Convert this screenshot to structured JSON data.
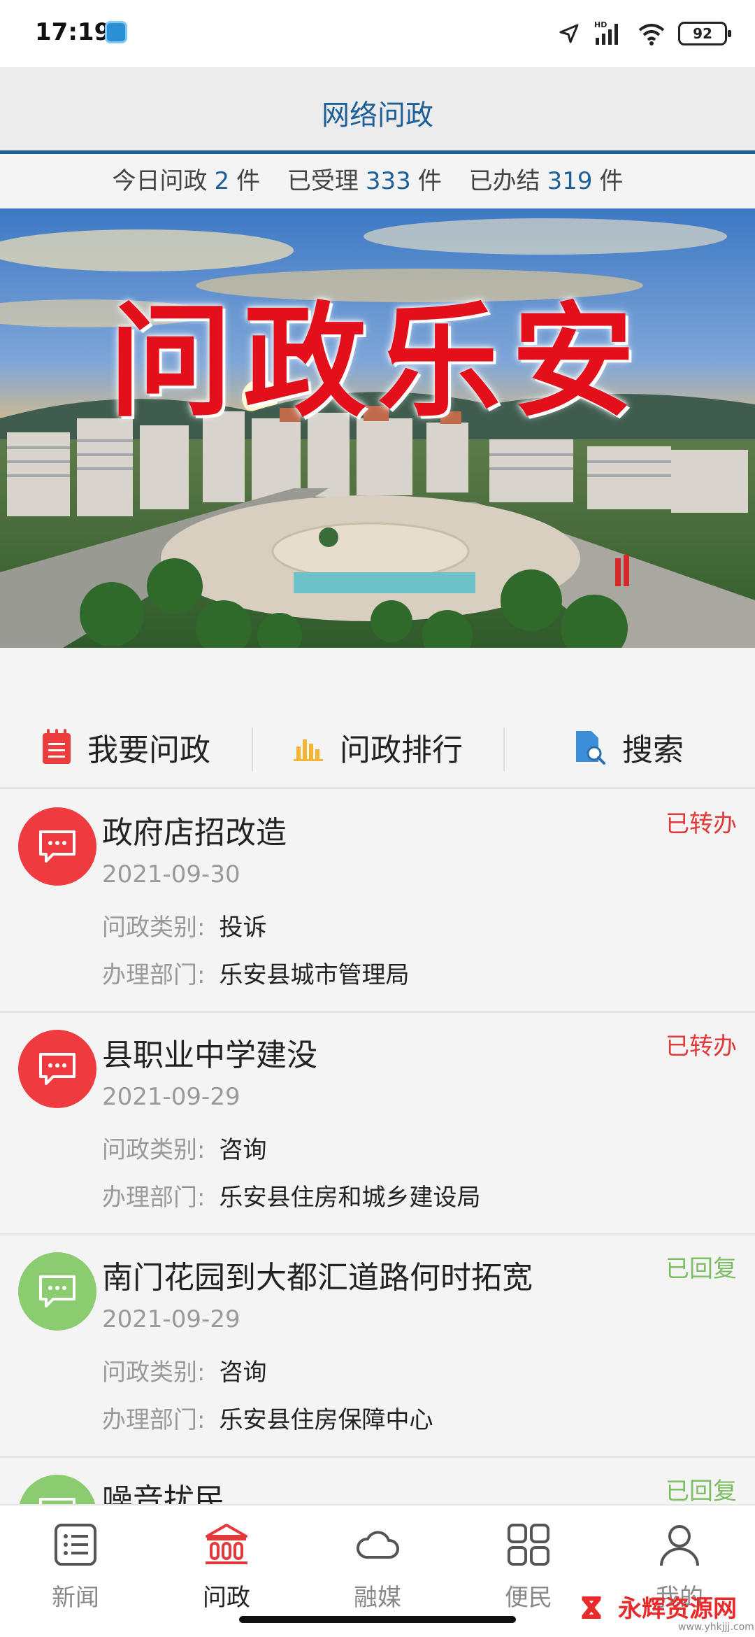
{
  "status_bar": {
    "time": "17:19",
    "network": "HD",
    "battery": "92"
  },
  "header": {
    "title": "网络问政"
  },
  "stats": {
    "today_label": "今日问政",
    "today_count": "2",
    "today_unit": "件",
    "accepted_label": "已受理",
    "accepted_count": "333",
    "accepted_unit": "件",
    "done_label": "已办结",
    "done_count": "319",
    "done_unit": "件"
  },
  "banner": {
    "title": "问政乐安"
  },
  "actions": [
    {
      "label": "我要问政",
      "icon": "clipboard-icon"
    },
    {
      "label": "问政排行",
      "icon": "bar-chart-icon"
    },
    {
      "label": "搜索",
      "icon": "search-doc-icon"
    }
  ],
  "field_labels": {
    "category": "问政类别:",
    "department": "办理部门:"
  },
  "items": [
    {
      "title": "政府店招改造",
      "date": "2021-09-30",
      "category": "投诉",
      "department": "乐安县城市管理局",
      "status": "已转办",
      "status_color": "#e23a3a",
      "avatar_color": "#ef3a3f"
    },
    {
      "title": "县职业中学建没",
      "date": "2021-09-29",
      "category": "咨询",
      "department": "乐安县住房和城乡建设局",
      "status": "已转办",
      "status_color": "#e23a3a",
      "avatar_color": "#ef3a3f"
    },
    {
      "title": "南门花园到大都汇道路何时拓宽",
      "date": "2021-09-29",
      "category": "咨询",
      "department": "乐安县住房保障中心",
      "status": "已回复",
      "status_color": "#7cbf62",
      "avatar_color": "#8ccc71"
    },
    {
      "title": "噪音扰民",
      "status": "已回复",
      "status_color": "#7cbf62",
      "avatar_color": "#8ccc71"
    }
  ],
  "tabs": [
    {
      "label": "新闻",
      "icon": "news-list-icon"
    },
    {
      "label": "问政",
      "icon": "government-building-icon",
      "active": true
    },
    {
      "label": "融媒",
      "icon": "cloud-icon"
    },
    {
      "label": "便民",
      "icon": "grid-icon"
    },
    {
      "label": "我的",
      "icon": "user-icon"
    }
  ],
  "watermark": {
    "text": "永辉资源网",
    "url": "www.yhkjjj.com"
  },
  "colors": {
    "accent": "#1d5f99",
    "red": "#e23a3a",
    "green": "#7cbf62"
  }
}
